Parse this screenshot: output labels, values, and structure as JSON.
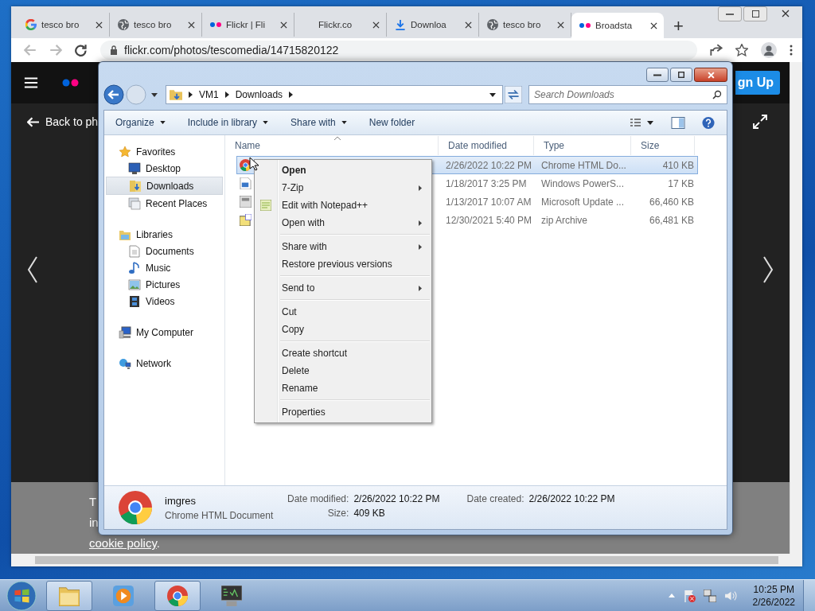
{
  "browser": {
    "tabs": [
      {
        "label": "tesco bro",
        "selected": false
      },
      {
        "label": "tesco bro",
        "selected": false
      },
      {
        "label": "Flickr | Fli",
        "selected": false
      },
      {
        "label": "Flickr.co",
        "selected": false
      },
      {
        "label": "Downloa",
        "selected": false
      },
      {
        "label": "tesco bro",
        "selected": false
      },
      {
        "label": "Broadsta",
        "selected": true
      }
    ],
    "new_tab": "+",
    "url": "flickr.com/photos/tescomedia/14715820122"
  },
  "page": {
    "back_link": "Back to ph",
    "signup": "gn Up",
    "cookie_lines": [
      "T",
      "in"
    ],
    "cookie_link": "cookie policy",
    "cookie_end": "."
  },
  "explorer": {
    "breadcrumb": [
      "VM1",
      "Downloads"
    ],
    "search": {
      "placeholder": "Search Downloads"
    },
    "toolbar": [
      {
        "label": "Organize",
        "dropdown": true
      },
      {
        "label": "Include in library",
        "dropdown": true
      },
      {
        "label": "Share with",
        "dropdown": true
      },
      {
        "label": "New folder",
        "dropdown": false
      }
    ],
    "nav": [
      {
        "label": "Favorites",
        "selected": false,
        "children": [
          {
            "label": "Desktop",
            "selected": false
          },
          {
            "label": "Downloads",
            "selected": true
          },
          {
            "label": "Recent Places",
            "selected": false
          }
        ]
      },
      {
        "label": "Libraries",
        "selected": false,
        "children": [
          {
            "label": "Documents",
            "selected": false
          },
          {
            "label": "Music",
            "selected": false
          },
          {
            "label": "Pictures",
            "selected": false
          },
          {
            "label": "Videos",
            "selected": false
          }
        ]
      },
      {
        "label": "My Computer",
        "selected": false
      },
      {
        "label": "Network",
        "selected": false
      }
    ],
    "columns": [
      "Name",
      "Date modified",
      "Type",
      "Size"
    ],
    "files": [
      {
        "date": "2/26/2022 10:22 PM",
        "type": "Chrome HTML Do...",
        "size": "410 KB",
        "selected": true
      },
      {
        "date": "1/18/2017 3:25 PM",
        "type": "Windows PowerS...",
        "size": "17 KB",
        "selected": false
      },
      {
        "date": "1/13/2017 10:07 AM",
        "type": "Microsoft Update ...",
        "size": "66,460 KB",
        "selected": false
      },
      {
        "date": "12/30/2021 5:40 PM",
        "type": "zip Archive",
        "size": "66,481 KB",
        "selected": false
      }
    ],
    "context_menu": [
      {
        "kind": "item",
        "label": "Open",
        "bold": true,
        "submenu": false
      },
      {
        "kind": "item",
        "label": "7-Zip",
        "bold": false,
        "submenu": true
      },
      {
        "kind": "item",
        "label": "Edit with Notepad++",
        "bold": false,
        "submenu": false
      },
      {
        "kind": "item",
        "label": "Open with",
        "bold": false,
        "submenu": true
      },
      {
        "kind": "separator"
      },
      {
        "kind": "item",
        "label": "Share with",
        "bold": false,
        "submenu": true
      },
      {
        "kind": "item",
        "label": "Restore previous versions",
        "bold": false,
        "submenu": false
      },
      {
        "kind": "separator"
      },
      {
        "kind": "item",
        "label": "Send to",
        "bold": false,
        "submenu": true
      },
      {
        "kind": "separator"
      },
      {
        "kind": "item",
        "label": "Cut",
        "bold": false,
        "submenu": false
      },
      {
        "kind": "item",
        "label": "Copy",
        "bold": false,
        "submenu": false
      },
      {
        "kind": "separator"
      },
      {
        "kind": "item",
        "label": "Create shortcut",
        "bold": false,
        "submenu": false
      },
      {
        "kind": "item",
        "label": "Delete",
        "bold": false,
        "submenu": false
      },
      {
        "kind": "item",
        "label": "Rename",
        "bold": false,
        "submenu": false
      },
      {
        "kind": "separator"
      },
      {
        "kind": "item",
        "label": "Properties",
        "bold": false,
        "submenu": false
      }
    ],
    "details": {
      "name": "imgres",
      "type": "Chrome HTML Document",
      "fields": [
        {
          "label": "Date modified:",
          "value": "2/26/2022 10:22 PM"
        },
        {
          "label": "Size:",
          "value": "409 KB"
        },
        {
          "label": "Date created:",
          "value": "2/26/2022 10:22 PM"
        }
      ]
    }
  },
  "taskbar": {
    "items": [
      {
        "active": true
      },
      {
        "active": false
      },
      {
        "active": true
      },
      {
        "active": false
      }
    ],
    "time": "10:25 PM",
    "date": "2/26/2022"
  }
}
